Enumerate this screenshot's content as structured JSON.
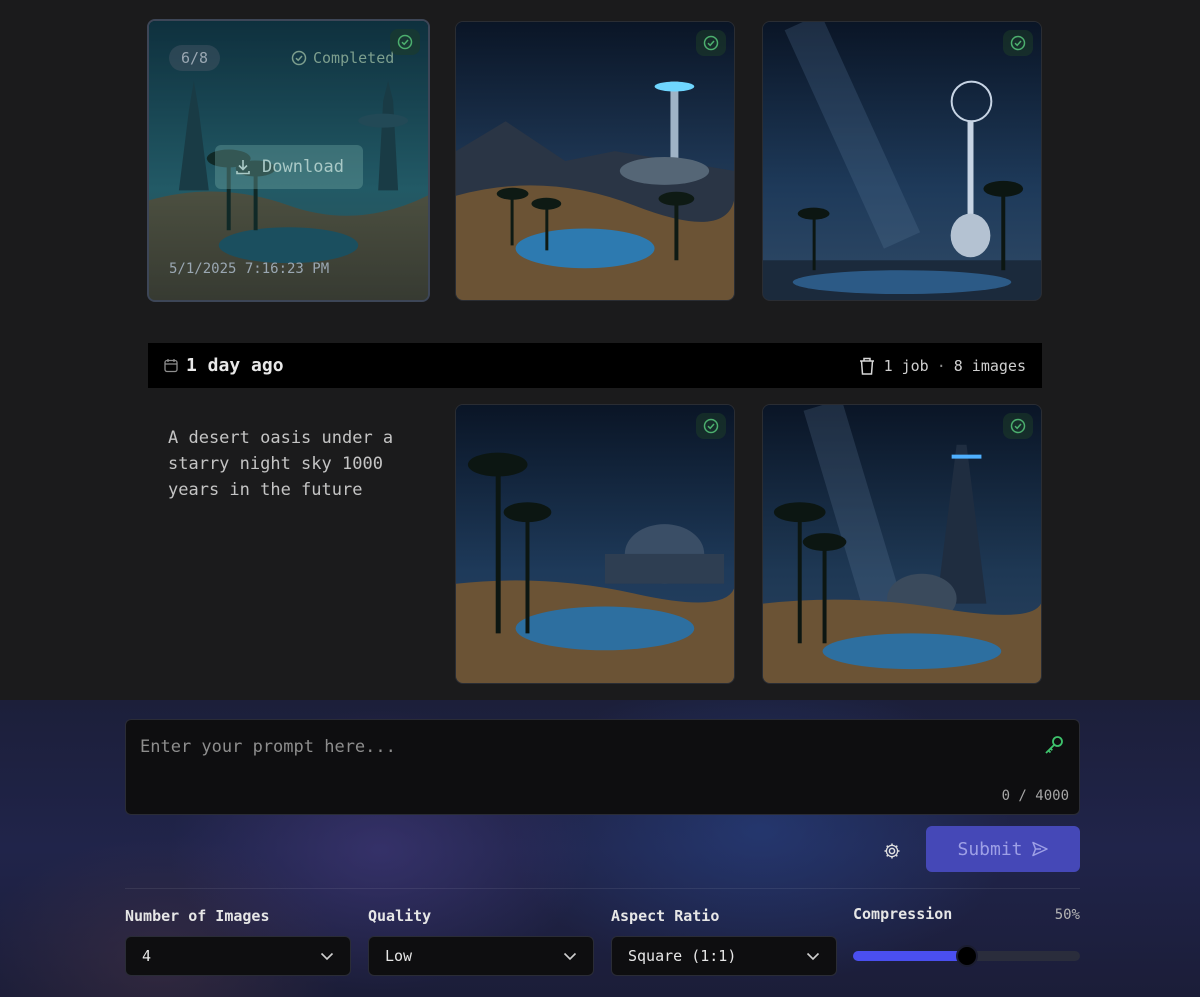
{
  "gallery": {
    "top_row": {
      "first_tile": {
        "counter": "6/8",
        "status": "Completed",
        "download_label": "Download",
        "timestamp": "5/1/2025 7:16:23 PM"
      }
    },
    "group": {
      "relative_time": "1 day ago",
      "job_count": "1 job",
      "separator": "·",
      "image_count": "8 images",
      "prompt": "A desert oasis under a starry night sky 1000 years in the future"
    }
  },
  "composer": {
    "placeholder": "Enter your prompt here...",
    "char_count": "0 / 4000",
    "submit_label": "Submit",
    "controls": {
      "num_images_label": "Number of Images",
      "num_images_value": "4",
      "quality_label": "Quality",
      "quality_value": "Low",
      "aspect_label": "Aspect Ratio",
      "aspect_value": "Square (1:1)",
      "compression_label": "Compression",
      "compression_value": "50%",
      "compression_level": 0.5
    }
  },
  "icons": {
    "check": "check-circle-icon",
    "download": "download-icon",
    "calendar": "calendar-icon",
    "trash": "trash-icon",
    "key": "key-icon",
    "settings": "gear-icon",
    "send": "send-icon",
    "chevron": "chevron-down-icon"
  },
  "colors": {
    "accent": "#4548b7",
    "success": "#4caf6e",
    "key": "#3ec26c",
    "slider_fill": "#4a4ff0"
  }
}
